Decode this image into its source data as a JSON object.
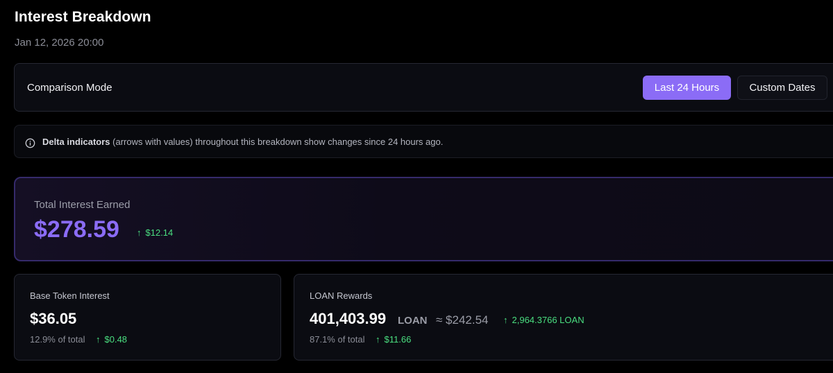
{
  "header": {
    "title": "Interest Breakdown",
    "timestamp": "Jan 12, 2026 20:00"
  },
  "comparison": {
    "label": "Comparison Mode",
    "options": [
      "Last 24 Hours",
      "Custom Dates"
    ],
    "selected": "Last 24 Hours",
    "accent_color": "#8b6cf6"
  },
  "info": {
    "icon": "info-icon",
    "bold": "Delta indicators",
    "text": " (arrows with values) throughout this breakdown show changes since 24 hours ago."
  },
  "total": {
    "label": "Total Interest Earned",
    "value": "$278.59",
    "delta": "$12.14",
    "delta_icon": "arrow-up-icon"
  },
  "base": {
    "label": "Base Token Interest",
    "value": "$36.05",
    "share": "12.9% of total",
    "delta": "$0.48"
  },
  "loan": {
    "label": "LOAN Rewards",
    "value": "401,403.99",
    "unit": "LOAN",
    "approx": "≈ $242.54",
    "token_delta": "2,964.3766 LOAN",
    "share": "87.1% of total",
    "delta": "$11.66"
  },
  "colors": {
    "positive": "#4ade80",
    "background": "#000000"
  }
}
